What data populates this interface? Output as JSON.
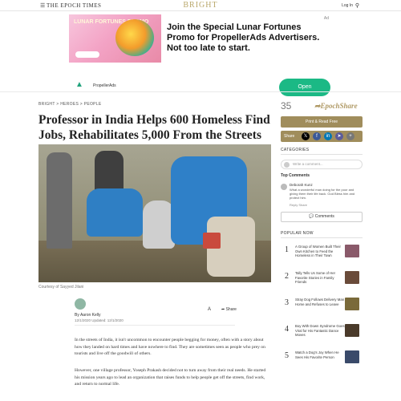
{
  "header": {
    "menu_icon": "menu-icon",
    "epoch_logo": "THE EPOCH TIMES",
    "bright_logo": "BRIGHT",
    "login_text": "Log In",
    "search_icon": "search-icon"
  },
  "ad": {
    "image_text": "LUNAR FORTUNES PROMO",
    "headline": "Join the Special Lunar Fortunes Promo for PropellerAds Advertisers. Not too late to start.",
    "advertiser": "PropellerAds",
    "cta": "Open",
    "ad_label": "Ad"
  },
  "article": {
    "breadcrumb": "BRIGHT  >  HEROES  >  PEOPLE",
    "title": "Professor in India Helps 600 Homeless Find Jobs, Rehabilitates 5,000 From the Streets",
    "photo_caption": "Courtesy of Sayyed Jilani",
    "author": "By Aaron Kelly",
    "date": "12/1/2020    Updated: 12/1/2020",
    "font_size_label": "A",
    "share_label": "Share",
    "body_p1": "In the streets of India, it isn't uncommon to encounter people begging for money, often with a story about how they landed on hard times and have nowhere to find. They are sometimes seen as people who prey on tourists and live off the goodwill of others.",
    "body_p2": "However, one village professor, Yoseph Prakash decided not to turn away from their real needs. He started his mission years ago to lead an organization that raises funds to help people get off the streets, find work, and return to normal life."
  },
  "sidebar": {
    "share_count": "35",
    "share_brand": "EpochShare",
    "print_label": "Print & Read Free",
    "share_label": "Share",
    "category_label": "CATEGORIES",
    "comment_placeholder": "Write a comment...",
    "top_comments_label": "Top Comments",
    "comment_author": "Deborah Kunz",
    "comment_text": "What a wonderful man doing for the poor and giving them their life back. God Bless him and protect him.",
    "comment_actions": "Reply   Share",
    "comments_button": "Comments",
    "popular_label": "POPULAR NOW",
    "popular": [
      {
        "num": "1",
        "text": "A Group of Women Built Their Own Kitchen to Feed the Homeless in Their Town",
        "color": "#8a5a6a"
      },
      {
        "num": "2",
        "text": "Tally Tells Us Some of Her Favorite Stories in Family Friends",
        "color": "#6a4b3a"
      },
      {
        "num": "3",
        "text": "Stray Dog Follows Delivery Man Home and Refuses to Leave",
        "color": "#7a6a3a"
      },
      {
        "num": "4",
        "text": "Boy With Down Syndrome Goes Viral for His Fantastic Dance Moves",
        "color": "#4a3a2a"
      },
      {
        "num": "5",
        "text": "Watch a Dog's Joy When He Sees His Favorite Person",
        "color": "#3a4a6a"
      }
    ]
  }
}
